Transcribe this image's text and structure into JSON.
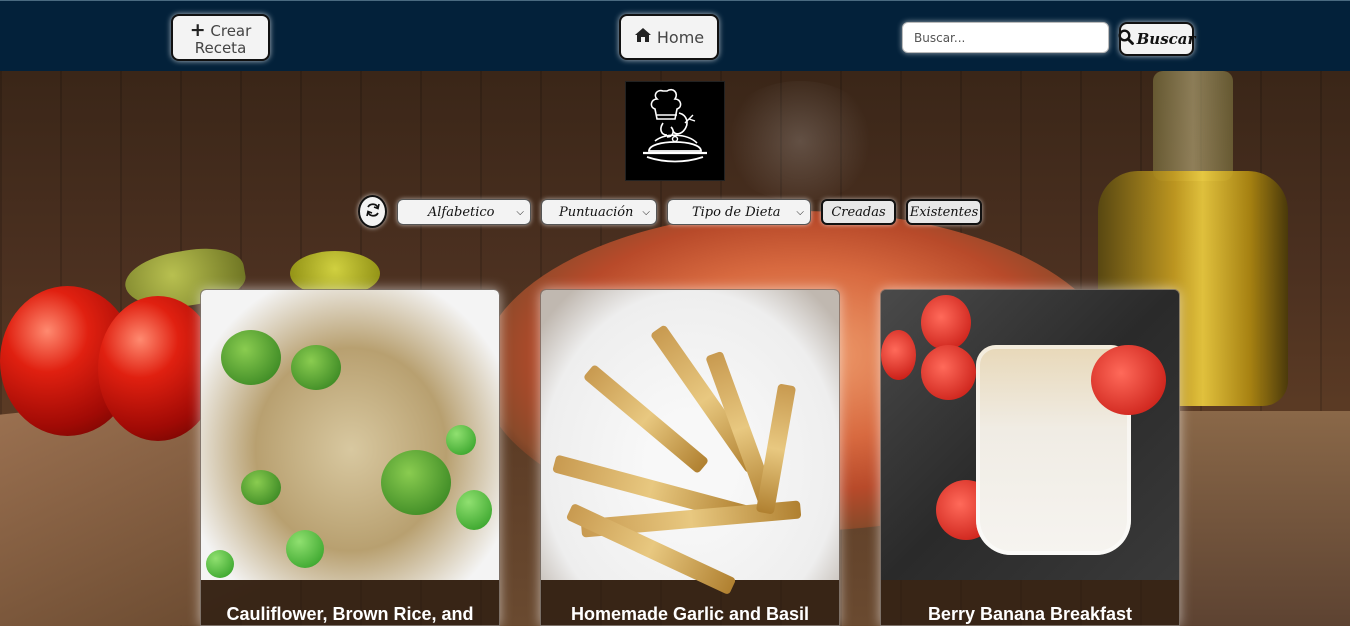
{
  "header": {
    "create_label": "Crear Receta",
    "home_label": "Home",
    "search_placeholder": "Buscar...",
    "search_label": "Buscar"
  },
  "filters": {
    "alphabetic": "Alfabetico",
    "score": "Puntuación",
    "diet": "Tipo de Dieta",
    "created": "Creadas",
    "existing": "Existentes"
  },
  "recipes": [
    {
      "title": "Cauliflower, Brown Rice, and"
    },
    {
      "title": "Homemade Garlic and Basil"
    },
    {
      "title": "Berry Banana Breakfast"
    }
  ],
  "colors": {
    "navbar": "#03213a",
    "button_bg": "#f3f3f3"
  },
  "icons": {
    "create": "plus-icon",
    "home": "home-icon",
    "search": "search-icon",
    "refresh": "refresh-icon",
    "logo": "chef-logo"
  }
}
